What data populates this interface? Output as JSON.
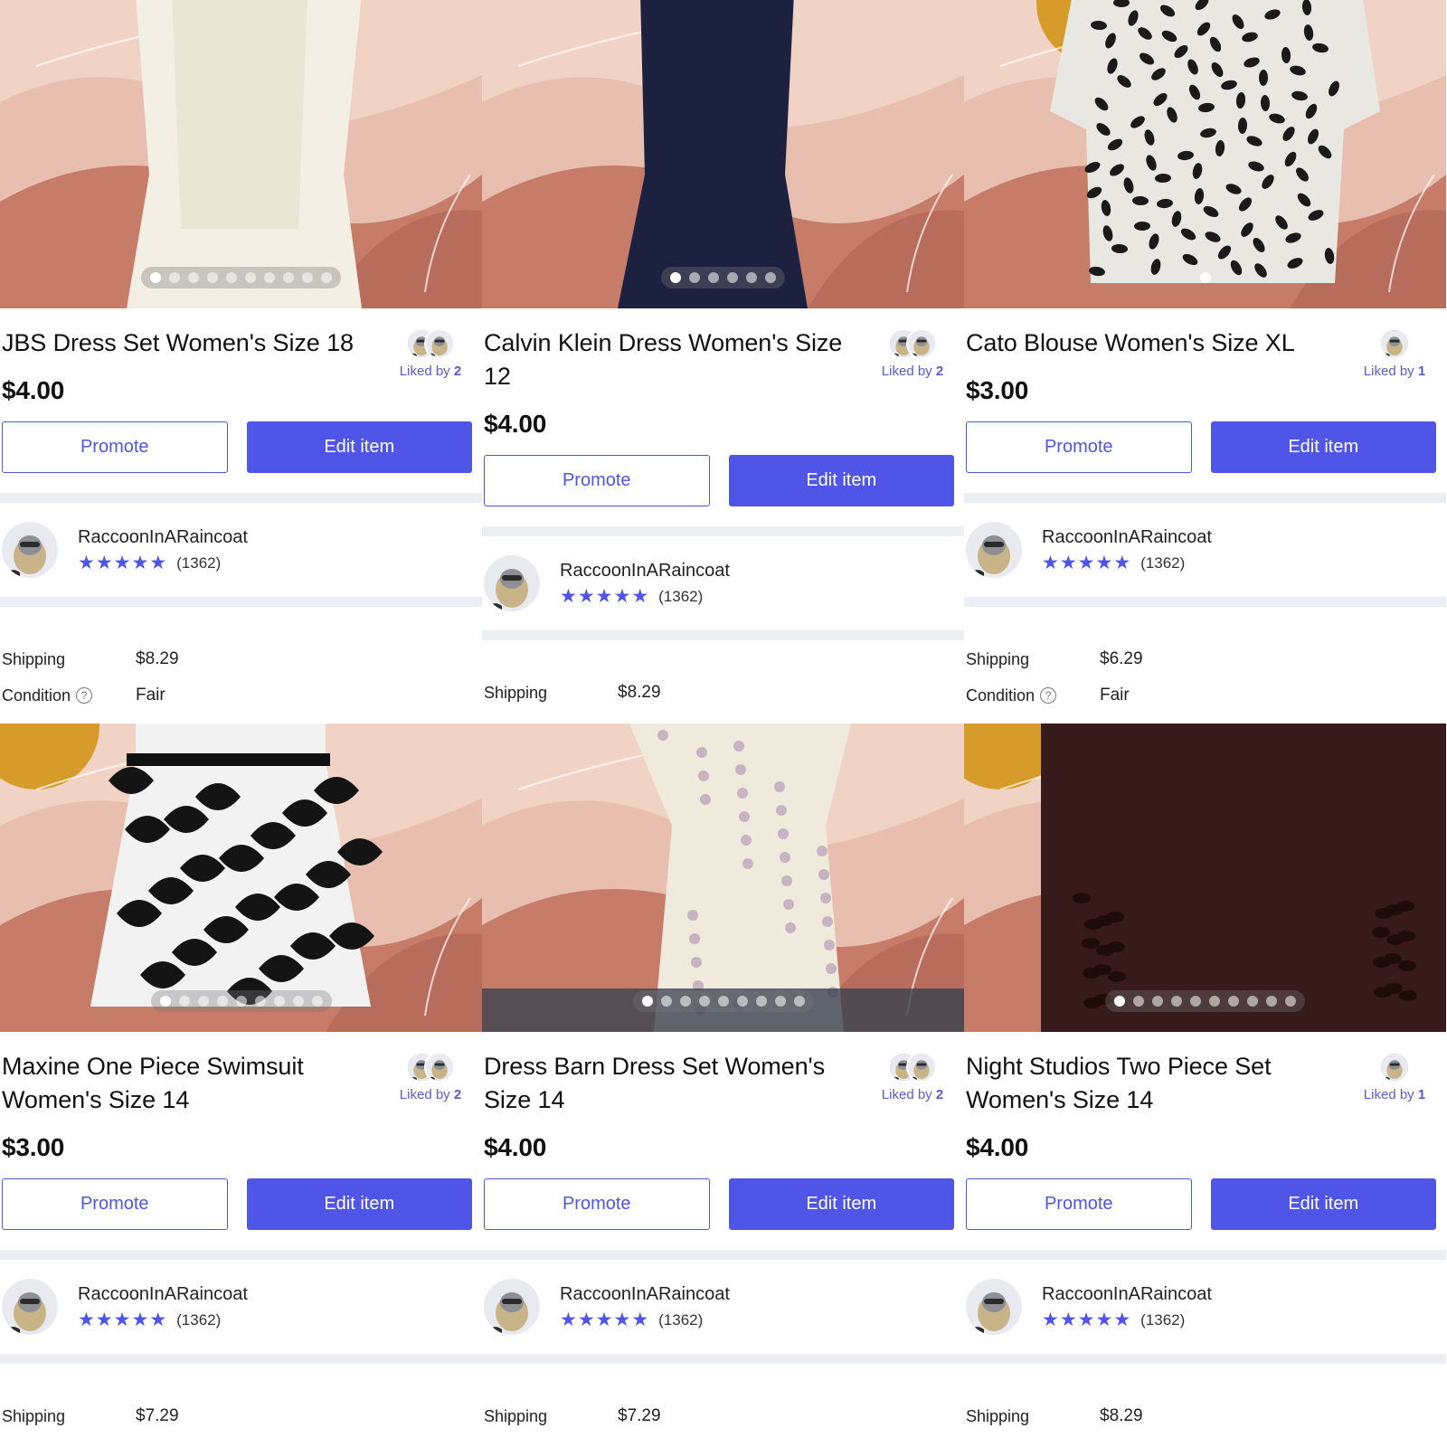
{
  "listings": [
    {
      "title": "JBS Dress Set Women's Size 18",
      "price": "$4.00",
      "liked_by_label": "Liked by",
      "liked_by_count": "2",
      "promote_label": "Promote",
      "edit_label": "Edit item",
      "seller_name": "RaccoonInARaincoat",
      "rating_count": "(1362)",
      "shipping_label": "Shipping",
      "shipping_value": "$8.29",
      "condition_label": "Condition",
      "condition_value": "Fair",
      "photo_count": 10,
      "photo_active": 1,
      "photo_theme": "white-dress-set",
      "liker_count": 2
    },
    {
      "title": "Calvin Klein Dress Women's Size 12",
      "price": "$4.00",
      "liked_by_label": "Liked by",
      "liked_by_count": "2",
      "promote_label": "Promote",
      "edit_label": "Edit item",
      "seller_name": "RaccoonInARaincoat",
      "rating_count": "(1362)",
      "shipping_label": "Shipping",
      "shipping_value": "$8.29",
      "photo_count": 6,
      "photo_active": 1,
      "photo_theme": "navy-dress",
      "liker_count": 2
    },
    {
      "title": "Cato Blouse Women's Size XL",
      "price": "$3.00",
      "liked_by_label": "Liked by",
      "liked_by_count": "1",
      "promote_label": "Promote",
      "edit_label": "Edit item",
      "seller_name": "RaccoonInARaincoat",
      "rating_count": "(1362)",
      "shipping_label": "Shipping",
      "shipping_value": "$6.29",
      "condition_label": "Condition",
      "condition_value": "Fair",
      "photo_count": 1,
      "photo_active": 1,
      "photo_theme": "leopard-blouse",
      "liker_count": 1
    },
    {
      "title": "Maxine One Piece Swimsuit Women's Size 14",
      "price": "$3.00",
      "liked_by_label": "Liked by",
      "liked_by_count": "2",
      "promote_label": "Promote",
      "edit_label": "Edit item",
      "seller_name": "RaccoonInARaincoat",
      "rating_count": "(1362)",
      "shipping_label": "Shipping",
      "shipping_value": "$7.29",
      "photo_count": 9,
      "photo_active": 1,
      "photo_theme": "bw-swimsuit",
      "liker_count": 2
    },
    {
      "title": "Dress Barn Dress Set Women's Size 14",
      "price": "$4.00",
      "liked_by_label": "Liked by",
      "liked_by_count": "2",
      "promote_label": "Promote",
      "edit_label": "Edit item",
      "seller_name": "RaccoonInARaincoat",
      "rating_count": "(1362)",
      "shipping_label": "Shipping",
      "shipping_value": "$7.29",
      "photo_count": 9,
      "photo_active": 1,
      "photo_theme": "floral-dress",
      "liker_count": 2
    },
    {
      "title": "Night Studios Two Piece Set Women's Size 14",
      "price": "$4.00",
      "liked_by_label": "Liked by",
      "liked_by_count": "1",
      "promote_label": "Promote",
      "edit_label": "Edit item",
      "seller_name": "RaccoonInARaincoat",
      "rating_count": "(1362)",
      "shipping_label": "Shipping",
      "shipping_value": "$8.29",
      "photo_count": 10,
      "photo_active": 1,
      "photo_theme": "brown-set",
      "liker_count": 1
    }
  ],
  "rating_stars": 5,
  "colors": {
    "accent": "#4f55e6",
    "separator": "#eceef3",
    "backdrop_pink": "#e8bfae",
    "backdrop_terracotta": "#c77c69",
    "backdrop_mustard": "#d79b2c"
  },
  "icons": {
    "star": "star-icon",
    "help": "question-circle-icon"
  }
}
